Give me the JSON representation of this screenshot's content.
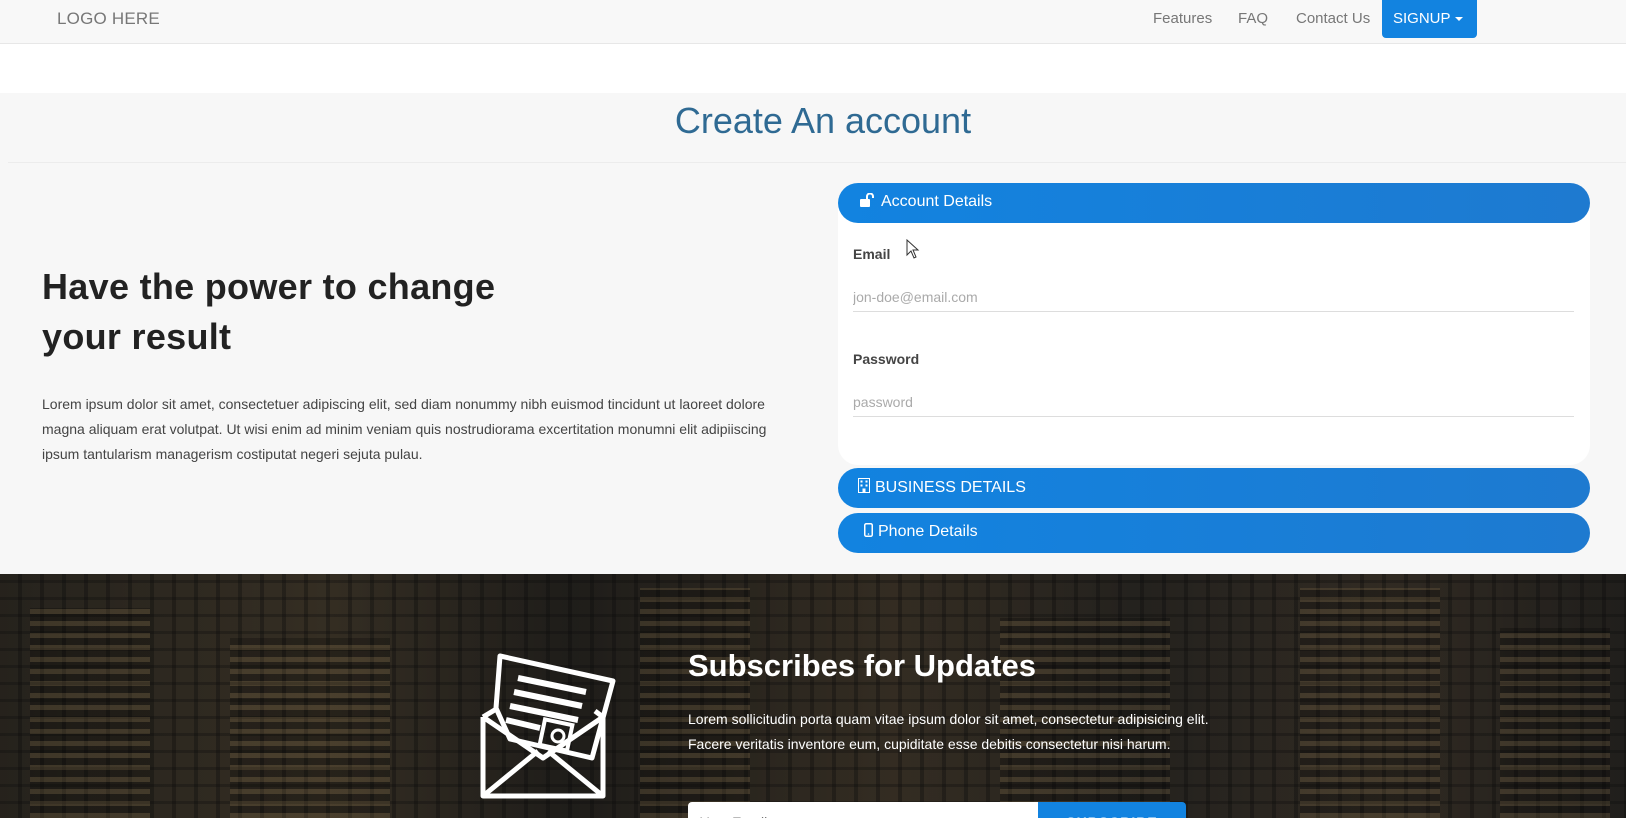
{
  "navbar": {
    "logo": "LOGO HERE",
    "links": [
      "Features",
      "FAQ",
      "Contact Us"
    ],
    "signup_label": "SIGNUP"
  },
  "account": {
    "title": "Create An account",
    "hero_heading_line1": "Have the power to change",
    "hero_heading_line2": "your result",
    "hero_text": "Lorem ipsum dolor sit amet, consectetuer adipiscing elit, sed diam nonummy nibh euismod tincidunt ut laoreet dolore magna aliquam erat volutpat. Ut wisi enim ad minim veniam quis nostrudiorama excertitation monumni elit adipiiscing ipsum tantularism managerism costiputat negeri sejuta pulau."
  },
  "accordion": {
    "account_details": {
      "label": "Account Details",
      "icon": "unlock-icon",
      "email_label": "Email",
      "email_value": "",
      "email_placeholder": "jon-doe@email.com",
      "password_label": "Password",
      "password_value": "",
      "password_placeholder": "password"
    },
    "business_details": {
      "label": "BUSINESS DETAILS",
      "icon": "building-icon"
    },
    "phone_details": {
      "label": "Phone Details",
      "icon": "mobile-icon"
    }
  },
  "subscribe": {
    "icon": "envelope-letter-icon",
    "title": "Subscribes for Updates",
    "text_line1": "Lorem sollicitudin porta quam vitae ipsum dolor sit amet, consectetur adipisicing elit.",
    "text_line2": "Facere veritatis inventore eum, cupiditate esse debitis consectetur nisi harum.",
    "input_placeholder": "Your Email",
    "button_label": "SUBSCRIBE"
  },
  "colors": {
    "accent": "#1283e0",
    "title": "#2f6a93",
    "section_bg": "#f7f7f7"
  }
}
